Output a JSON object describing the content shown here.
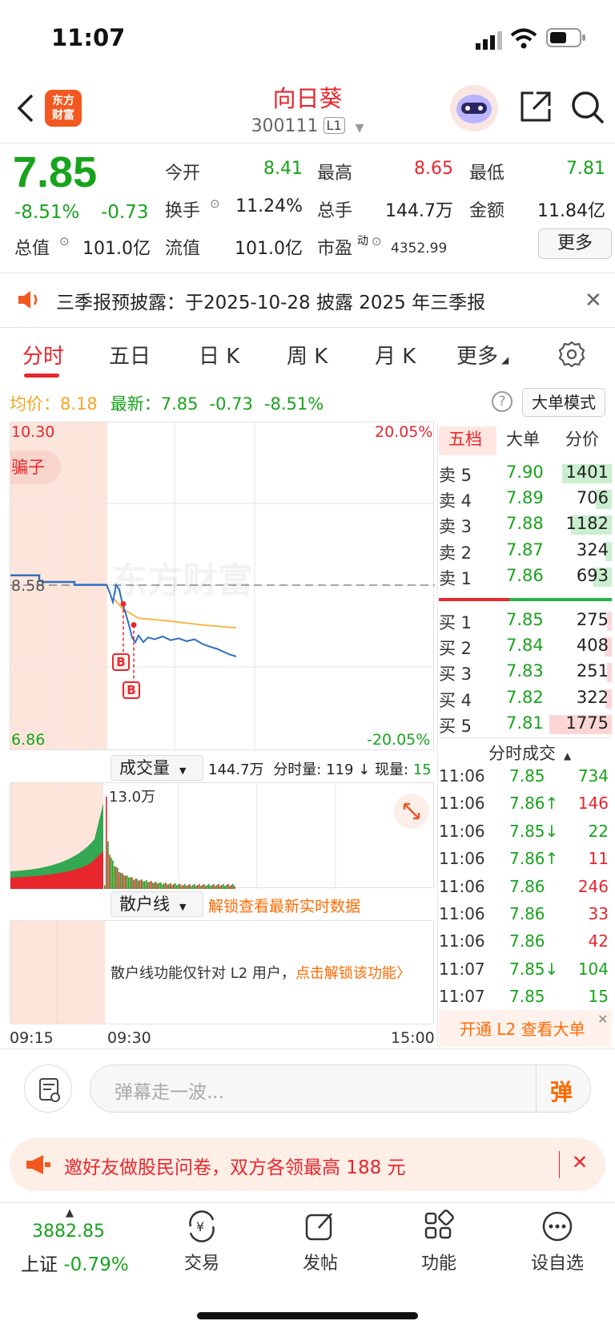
{
  "status": {
    "time": "11:07"
  },
  "header": {
    "title": "向日葵",
    "code": "300111",
    "level_badge": "L1",
    "logo_text": "东方财富"
  },
  "quote": {
    "price": "7.85",
    "change_pct": "-8.51%",
    "change": "-0.73",
    "open_label": "今开",
    "open": "8.41",
    "high_label": "最高",
    "high": "8.65",
    "low_label": "最低",
    "low": "7.81",
    "turnover_label": "换手",
    "turnover": "11.24%",
    "volume_label": "总手",
    "volume": "144.7万",
    "amount_label": "金额",
    "amount": "11.84亿",
    "mktcap_label": "总值",
    "mktcap": "101.0亿",
    "float_label": "流值",
    "float": "101.0亿",
    "pe_label": "市盈",
    "pe_sup": "动",
    "pe": "4352.99",
    "more_button": "更多"
  },
  "notice": {
    "text": "三季报预披露：于2025-10-28 披露 2025 年三季报"
  },
  "tabs": [
    "分时",
    "五日",
    "日 K",
    "周 K",
    "月 K",
    "更多"
  ],
  "sub_row": {
    "avg_label": "均价：",
    "avg": "8.18",
    "latest_label": "最新：",
    "latest": "7.85",
    "change": "-0.73",
    "change_pct": "-8.51%",
    "big_mode": "大单模式"
  },
  "chart": {
    "y_top": "10.30",
    "y_bottom": "6.86",
    "y_ref": "8.58",
    "pct_top": "20.05%",
    "pct_bottom": "-20.05%",
    "tag": "骗子",
    "watermark": "东方财富",
    "marker_b": "B",
    "volume_label": "成交量",
    "volume_total": "144.7万",
    "time_vol_label": "分时量:",
    "time_vol": "119",
    "cur_vol_label": "现量:",
    "cur_vol": "15",
    "vol_peak": "13.0万",
    "retail_label": "散户线",
    "unlock_link": "解锁查看最新实时数据",
    "retail_note": "散户线功能仅针对 L2 用户，",
    "retail_link": "点击解锁该功能",
    "t_start": "09:15",
    "t_open": "09:30",
    "t_end": "15:00",
    "price_line_color": "#2f6fbf",
    "avg_line_color": "#f6b84a"
  },
  "order_book": {
    "tabs": [
      "五档",
      "大单",
      "分价"
    ],
    "asks": [
      {
        "label": "卖 5",
        "price": "7.90",
        "vol": "1401",
        "bar": 0.79
      },
      {
        "label": "卖 4",
        "price": "7.89",
        "vol": "706",
        "bar": 0.25
      },
      {
        "label": "卖 3",
        "price": "7.88",
        "vol": "1182",
        "bar": 0.66
      },
      {
        "label": "卖 2",
        "price": "7.87",
        "vol": "324",
        "bar": 0.1
      },
      {
        "label": "卖 1",
        "price": "7.86",
        "vol": "693",
        "bar": 0.3
      }
    ],
    "bids": [
      {
        "label": "买 1",
        "price": "7.85",
        "vol": "275",
        "bar": 0.08
      },
      {
        "label": "买 2",
        "price": "7.84",
        "vol": "408",
        "bar": 0.12
      },
      {
        "label": "买 3",
        "price": "7.83",
        "vol": "251",
        "bar": 0.06
      },
      {
        "label": "买 4",
        "price": "7.82",
        "vol": "322",
        "bar": 0.1
      },
      {
        "label": "买 5",
        "price": "7.81",
        "vol": "1775",
        "bar": 1.0
      }
    ],
    "trades_label": "分时成交",
    "trades": [
      {
        "time": "11:06",
        "price": "7.85",
        "dir": "",
        "vol": "734",
        "color": "green"
      },
      {
        "time": "11:06",
        "price": "7.86",
        "dir": "↑",
        "vol": "146",
        "color": "red"
      },
      {
        "time": "11:06",
        "price": "7.85",
        "dir": "↓",
        "vol": "22",
        "color": "green"
      },
      {
        "time": "11:06",
        "price": "7.86",
        "dir": "↑",
        "vol": "11",
        "color": "red"
      },
      {
        "time": "11:06",
        "price": "7.86",
        "dir": "",
        "vol": "246",
        "color": "red"
      },
      {
        "time": "11:06",
        "price": "7.86",
        "dir": "",
        "vol": "33",
        "color": "red"
      },
      {
        "time": "11:06",
        "price": "7.86",
        "dir": "",
        "vol": "42",
        "color": "red"
      },
      {
        "time": "11:07",
        "price": "7.85",
        "dir": "↓",
        "vol": "104",
        "color": "green"
      },
      {
        "time": "11:07",
        "price": "7.85",
        "dir": "",
        "vol": "15",
        "color": "green"
      }
    ],
    "l2_link": "开通 L2 查看大单"
  },
  "comment": {
    "placeholder": "弹幕走一波...",
    "send": "弹"
  },
  "promo": {
    "text": "邀好友做股民问卷，双方各领最高 188 元"
  },
  "bottom_nav": {
    "index_value": "3882.85",
    "index_name": "上证",
    "index_change": "-0.79%",
    "items": [
      "交易",
      "发帖",
      "功能",
      "设自选"
    ]
  }
}
